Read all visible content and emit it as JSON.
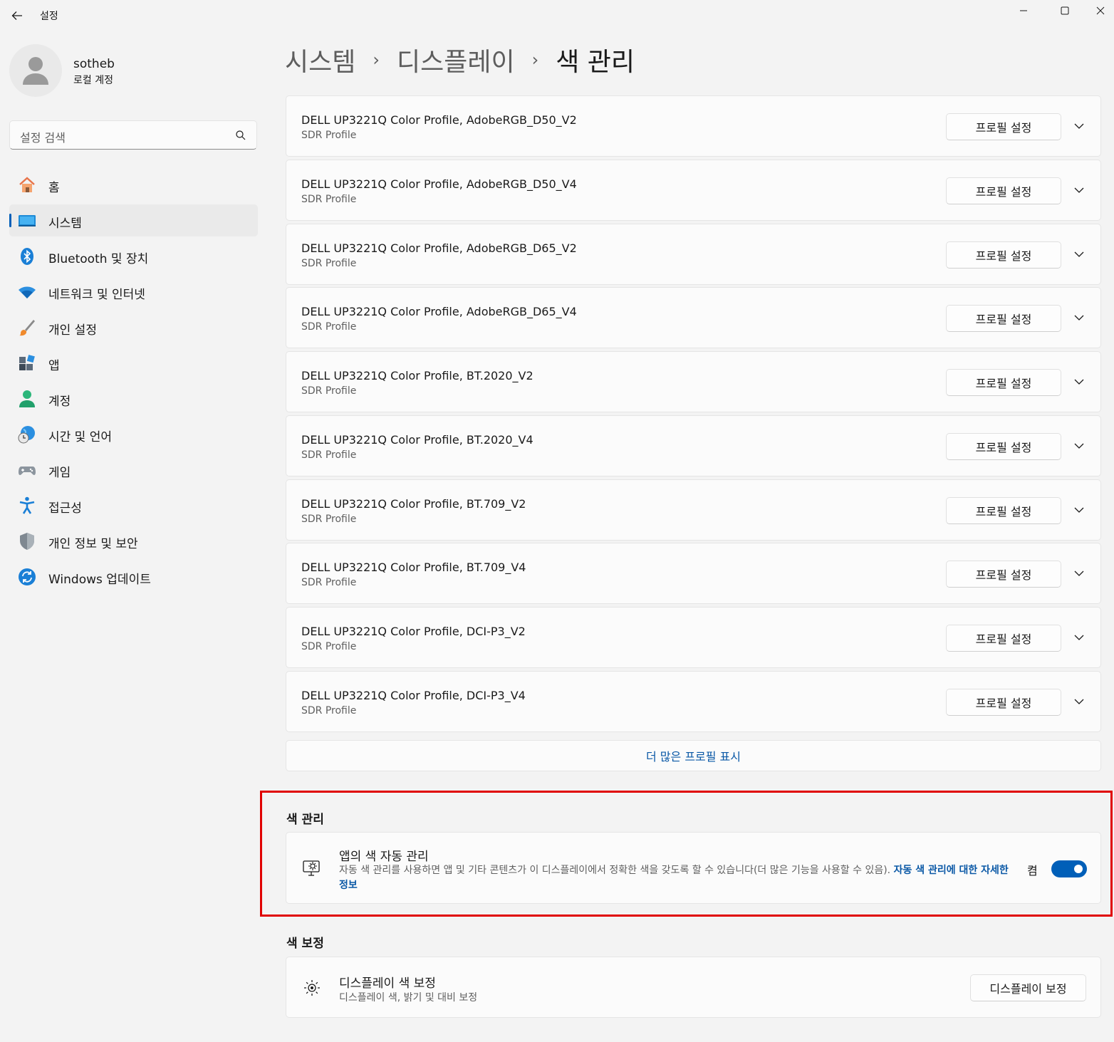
{
  "window": {
    "title": "설정",
    "back_icon": "arrow-left-icon",
    "controls": [
      "minimize-icon",
      "maximize-icon",
      "close-icon"
    ]
  },
  "user": {
    "name": "sotheb",
    "account_type": "로컬 계정"
  },
  "search": {
    "placeholder": "설정 검색"
  },
  "nav": {
    "items": [
      {
        "label": "홈",
        "icon": "home-icon",
        "active": false
      },
      {
        "label": "시스템",
        "icon": "system-icon",
        "active": true
      },
      {
        "label": "Bluetooth 및 장치",
        "icon": "bluetooth-icon",
        "active": false
      },
      {
        "label": "네트워크 및 인터넷",
        "icon": "wifi-icon",
        "active": false
      },
      {
        "label": "개인 설정",
        "icon": "brush-icon",
        "active": false
      },
      {
        "label": "앱",
        "icon": "apps-icon",
        "active": false
      },
      {
        "label": "계정",
        "icon": "account-icon",
        "active": false
      },
      {
        "label": "시간 및 언어",
        "icon": "globe-clock-icon",
        "active": false
      },
      {
        "label": "게임",
        "icon": "gamepad-icon",
        "active": false
      },
      {
        "label": "접근성",
        "icon": "accessibility-icon",
        "active": false
      },
      {
        "label": "개인 정보 및 보안",
        "icon": "shield-icon",
        "active": false
      },
      {
        "label": "Windows 업데이트",
        "icon": "update-icon",
        "active": false
      }
    ]
  },
  "breadcrumb": {
    "items": [
      "시스템",
      "디스플레이"
    ],
    "current": "색 관리",
    "separator": "›"
  },
  "profiles": {
    "button_label": "프로필 설정",
    "items": [
      {
        "name": "DELL UP3221Q Color Profile, AdobeRGB_D50_V2",
        "type": "SDR Profile"
      },
      {
        "name": "DELL UP3221Q Color Profile, AdobeRGB_D50_V4",
        "type": "SDR Profile"
      },
      {
        "name": "DELL UP3221Q Color Profile, AdobeRGB_D65_V2",
        "type": "SDR Profile"
      },
      {
        "name": "DELL UP3221Q Color Profile, AdobeRGB_D65_V4",
        "type": "SDR Profile"
      },
      {
        "name": "DELL UP3221Q Color Profile, BT.2020_V2",
        "type": "SDR Profile"
      },
      {
        "name": "DELL UP3221Q Color Profile, BT.2020_V4",
        "type": "SDR Profile"
      },
      {
        "name": "DELL UP3221Q Color Profile, BT.709_V2",
        "type": "SDR Profile"
      },
      {
        "name": "DELL UP3221Q Color Profile, BT.709_V4",
        "type": "SDR Profile"
      },
      {
        "name": "DELL UP3221Q Color Profile, DCI-P3_V2",
        "type": "SDR Profile"
      },
      {
        "name": "DELL UP3221Q Color Profile, DCI-P3_V4",
        "type": "SDR Profile"
      }
    ],
    "show_more": "더 많은 프로필 표시"
  },
  "color_management": {
    "section_title": "색 관리",
    "title": "앱의 색 자동 관리",
    "description": "자동 색 관리를 사용하면 앱 및 기타 콘텐츠가 이 디스플레이에서 정확한 색을 갖도록 할 수 있습니다(더 많은 기능을 사용할 수 있음). ",
    "link": "자동 색 관리에 대한 자세한 정보",
    "toggle_label": "켬",
    "toggle_on": true
  },
  "calibration": {
    "section_title": "색 보정",
    "title": "디스플레이 색 보정",
    "subtitle": "디스플레이 색, 밝기 및 대비 보정",
    "button_label": "디스플레이 보정"
  },
  "colors": {
    "accent": "#005fb8",
    "link": "#0a58a6",
    "highlight_border": "#e00000"
  }
}
